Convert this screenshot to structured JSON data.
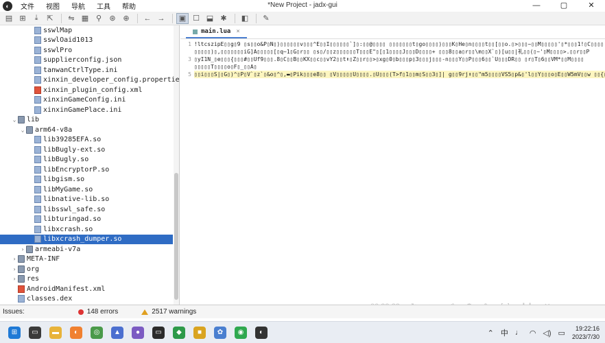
{
  "window": {
    "title": "*New Project - jadx-gui",
    "menu": [
      "文件",
      "视图",
      "导航",
      "工具",
      "帮助"
    ]
  },
  "tree": {
    "items": [
      {
        "label": "sswlMap",
        "level": 3,
        "type": "file"
      },
      {
        "label": "sswlOaid1013",
        "level": 3,
        "type": "file"
      },
      {
        "label": "sswlPro",
        "level": 3,
        "type": "file"
      },
      {
        "label": "supplierconfig.json",
        "level": 3,
        "type": "file"
      },
      {
        "label": "tanwanCtrlType.ini",
        "level": 3,
        "type": "file"
      },
      {
        "label": "xinxin_developer_config.propertie",
        "level": 3,
        "type": "file"
      },
      {
        "label": "xinxin_plugin_config.xml",
        "level": 3,
        "type": "xml"
      },
      {
        "label": "xinxinGameConfig.ini",
        "level": 3,
        "type": "file"
      },
      {
        "label": "xinxinGamePlace.ini",
        "level": 3,
        "type": "file"
      },
      {
        "label": "lib",
        "level": 1,
        "type": "folder",
        "arrow": "⌄"
      },
      {
        "label": "arm64-v8a",
        "level": 2,
        "type": "folder",
        "arrow": "⌄"
      },
      {
        "label": "lib39285EFA.so",
        "level": 3,
        "type": "file"
      },
      {
        "label": "libBugly-ext.so",
        "level": 3,
        "type": "file"
      },
      {
        "label": "libBugly.so",
        "level": 3,
        "type": "file"
      },
      {
        "label": "libEncryptorP.so",
        "level": 3,
        "type": "file"
      },
      {
        "label": "libgism.so",
        "level": 3,
        "type": "file"
      },
      {
        "label": "libMyGame.so",
        "level": 3,
        "type": "file"
      },
      {
        "label": "libnative-lib.so",
        "level": 3,
        "type": "file"
      },
      {
        "label": "libsswl_safe.so",
        "level": 3,
        "type": "file"
      },
      {
        "label": "libturingad.so",
        "level": 3,
        "type": "file"
      },
      {
        "label": "libxcrash.so",
        "level": 3,
        "type": "file"
      },
      {
        "label": "libxcrash_dumper.so",
        "level": 3,
        "type": "file",
        "selected": true
      },
      {
        "label": "armeabi-v7a",
        "level": 2,
        "type": "folder",
        "arrow": "›"
      },
      {
        "label": "META-INF",
        "level": 1,
        "type": "folder",
        "arrow": "›"
      },
      {
        "label": "org",
        "level": 1,
        "type": "folder",
        "arrow": "›"
      },
      {
        "label": "res",
        "level": 1,
        "type": "folder",
        "arrow": "›"
      },
      {
        "label": "AndroidManifest.xml",
        "level": 1,
        "type": "xml"
      },
      {
        "label": "classes.dex",
        "level": 1,
        "type": "file"
      }
    ]
  },
  "editor": {
    "tab_label": "main.lua",
    "line_numbers": [
      "1",
      "",
      "3",
      "",
      "5"
    ],
    "lines": [
      "!ltcszipE▯▯g▯9 ▯s▯▯o&P▯N▯)▯▯▯▯▯▯v▯▯▯^E▯▯I▯▯▯▯▯▯`]▯:▯▯@▯▯▯▯ ▯▯▯▯▯▯▯t▯go▯▯▯▯)▯▯▯K▯He▯n▯▯▯▯t▯▯[▯▯o.▯>▯▯▯~▯▯M▯▯▯▯▯'▯*▯▯▯1!▯C▯▯▯▯",
      "▯▯▯▯▯)▯,▯▯▯▯▯▯▯iG]A▯▯▯▯▯[▯q~1▯G▯r▯▯    ▯s▯/▯▯z▯▯▯▯▯▯T▯▯▯E\"▯[▯1▯▯▯▯J▯▯▯D▯▯▯▯+ ▯▯▯8▯▯a▯r▯▯\\m▯▯X`▯)[u▯▯|礼▯▯(▯~'▯M▯▯▯▯>.▯▯r▯▯P",
      "▯yI1N_▯e▯▯▯{▯▯▯#▯▯Uf9▯▯▯.8▯C▯▯B▯▯KX▯▯c▯▯vY2▯▯t⬆▯Z▯▯r▯▯>▯xg▯0▯b▯▯▯p▯3▯▯▯j▯▯▯-n▯▯▯Y▯▯P▯▯▯6▯▯`U▯▯▯DR▯▯   ▯r▯T▯6▯▯VM*▯▯M▯▯▯▯",
      "▯▯▯▯▯T▯▯▯▯o▯F▯_▯▯A▯",
      "▯▯i▯▯▯S|▯G▯)^▯P▯V`▯z`▯&o▯^▯,▬▯Pik▯▯▯e8▯▯ ▯V▯▯▯▯▯U▯▯▯▯.▯U▯▯▯(T>f▯1▯▯m▯S▯▯3▯]| g▯▯9rj⬆▯▯\"m5▯▯▯▯VS5▯p&▯'l▯▯Y▯▯▯o▯E▯▯W5mV▯▯w  ▯▯{▯"
    ]
  },
  "overlay": {
    "time": "00:33:23"
  },
  "status": {
    "issues_label": "Issues:",
    "errors": "148 errors",
    "warnings": "2517 warnings"
  },
  "taskbar": {
    "time": "19:22:16",
    "date": "2023/7/30"
  }
}
